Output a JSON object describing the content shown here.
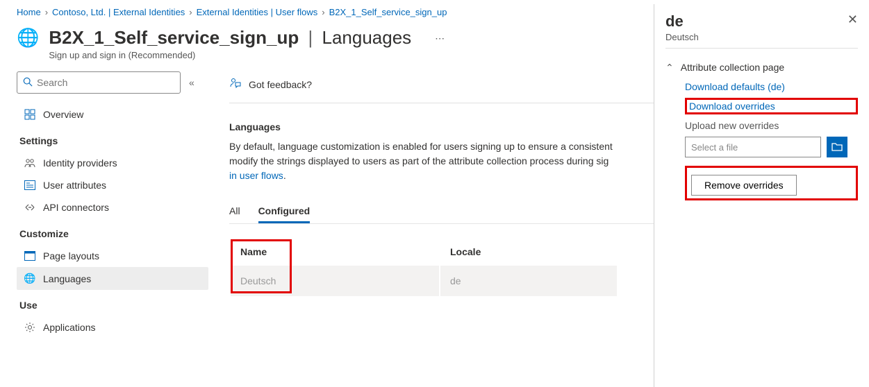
{
  "breadcrumb": [
    {
      "label": "Home"
    },
    {
      "label": "Contoso, Ltd. | External Identities"
    },
    {
      "label": "External Identities | User flows"
    },
    {
      "label": "B2X_1_Self_service_sign_up"
    }
  ],
  "header": {
    "title": "B2X_1_Self_service_sign_up",
    "separator": "|",
    "subtitle": "Languages",
    "description": "Sign up and sign in (Recommended)",
    "more": "⋯"
  },
  "search": {
    "placeholder": "Search"
  },
  "nav": {
    "overview": "Overview",
    "section_settings": "Settings",
    "identity_providers": "Identity providers",
    "user_attributes": "User attributes",
    "api_connectors": "API connectors",
    "section_customize": "Customize",
    "page_layouts": "Page layouts",
    "languages": "Languages",
    "section_use": "Use",
    "applications": "Applications"
  },
  "feedback": {
    "label": "Got feedback?"
  },
  "main": {
    "section_title": "Languages",
    "description_prefix": "By default, language customization is enabled for users signing up to ensure a consistent",
    "description_line2": " modify the strings displayed to users as part of the attribute collection process during sig",
    "link_text": "in user flows",
    "link_suffix": ".",
    "tabs": {
      "all": "All",
      "configured": "Configured"
    },
    "table": {
      "col_name": "Name",
      "col_locale": "Locale",
      "rows": [
        {
          "name": "Deutsch",
          "locale": "de"
        }
      ]
    }
  },
  "panel": {
    "title": "de",
    "subtitle": "Deutsch",
    "accordion": "Attribute collection page",
    "download_defaults": "Download defaults (de)",
    "download_overrides": "Download overrides",
    "upload_label": "Upload new overrides",
    "file_placeholder": "Select a file",
    "remove_overrides": "Remove overrides"
  }
}
